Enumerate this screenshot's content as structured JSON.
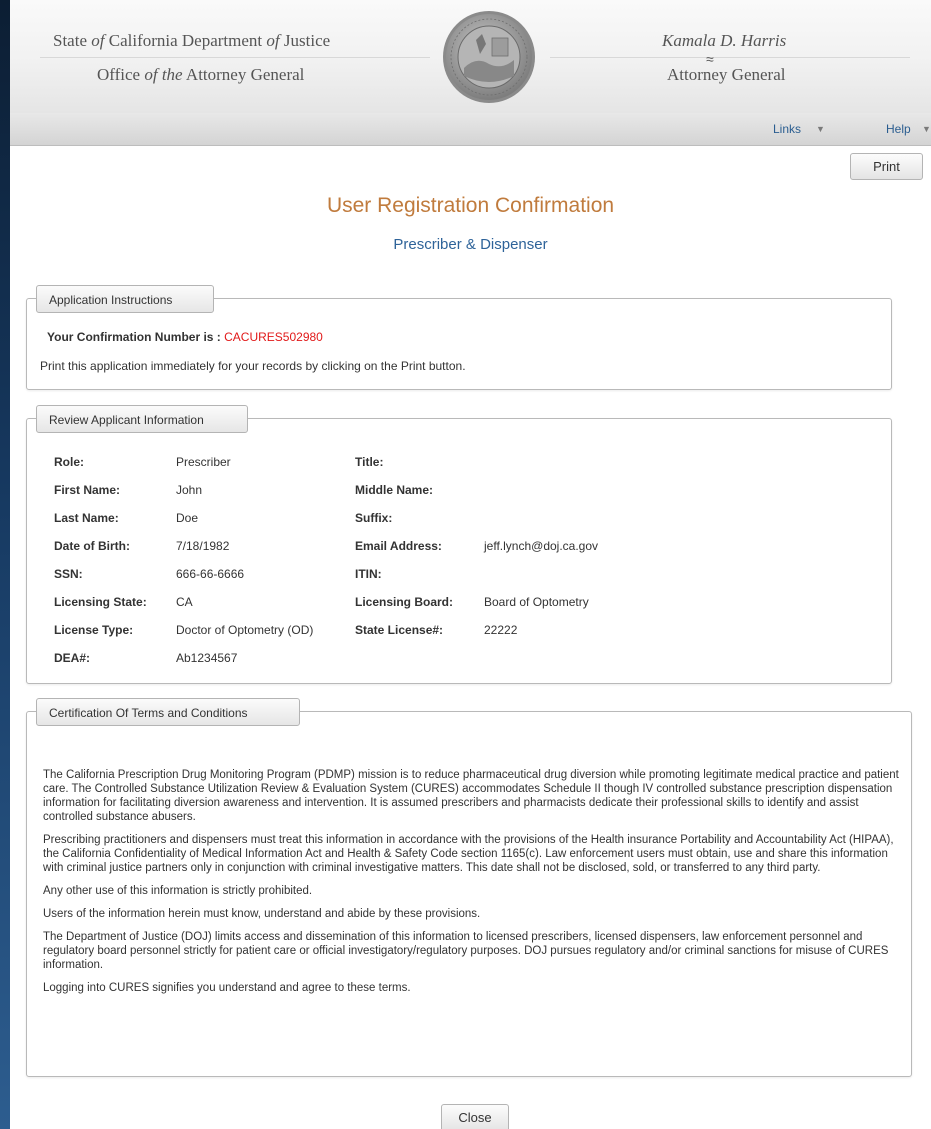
{
  "header": {
    "dept_line1_a": "State ",
    "dept_line1_b": "of",
    "dept_line1_c": " California Department ",
    "dept_line1_d": "of",
    "dept_line1_e": " Justice",
    "dept_line2_a": "Office ",
    "dept_line2_b": "of the",
    "dept_line2_c": " Attorney General",
    "ag_name": "Kamala D. Harris",
    "ag_title": "Attorney General"
  },
  "nav": {
    "links": "Links",
    "help": "Help"
  },
  "print_label": "Print",
  "page_title": "User Registration Confirmation",
  "page_subtitle": "Prescriber & Dispenser",
  "instructions": {
    "legend": "Application Instructions",
    "confirm_label": "Your Confirmation Number is : ",
    "confirm_number": "CACURES502980",
    "note": "Print this application immediately for your records by clicking on the Print button."
  },
  "review": {
    "legend": "Review Applicant Information",
    "left": [
      {
        "label": "Role:",
        "value": "Prescriber"
      },
      {
        "label": "First Name:",
        "value": "John"
      },
      {
        "label": "Last Name:",
        "value": "Doe"
      },
      {
        "label": "Date of Birth:",
        "value": "7/18/1982"
      },
      {
        "label": "SSN:",
        "value": "666-66-6666"
      },
      {
        "label": "Licensing State:",
        "value": "CA"
      },
      {
        "label": "License Type:",
        "value": "Doctor of Optometry (OD)"
      },
      {
        "label": "DEA#:",
        "value": "Ab1234567"
      }
    ],
    "right": [
      {
        "label": "Title:",
        "value": ""
      },
      {
        "label": "Middle Name:",
        "value": ""
      },
      {
        "label": "Suffix:",
        "value": ""
      },
      {
        "label": "Email Address:",
        "value": "jeff.lynch@doj.ca.gov"
      },
      {
        "label": "ITIN:",
        "value": ""
      },
      {
        "label": "Licensing Board:",
        "value": "Board of Optometry"
      },
      {
        "label": "State License#:",
        "value": "22222"
      }
    ]
  },
  "terms": {
    "legend": "Certification Of Terms and Conditions",
    "paragraphs": [
      "The California Prescription Drug Monitoring Program (PDMP) mission is to reduce pharmaceutical drug diversion while promoting legitimate medical practice and patient care. The Controlled Substance Utilization Review & Evaluation System (CURES) accommodates Schedule II though IV controlled substance prescription dispensation information for facilitating diversion awareness and intervention. It is assumed prescribers and pharmacists dedicate their professional skills to identify and assist controlled substance abusers.",
      "Prescribing practitioners and dispensers must treat this information in accordance with the provisions of the Health insurance Portability and Accountability Act (HIPAA), the California Confidentiality of Medical Information Act and Health & Safety Code section 1165(c). Law enforcement users must obtain, use and share this information with criminal justice partners only in conjunction with criminal investigative matters. This date shall not be disclosed, sold, or transferred to any third party.",
      "Any other use of this information is strictly prohibited.",
      "Users of the information herein must know, understand and abide by these provisions.",
      "The Department of Justice (DOJ) limits access and dissemination of this information to licensed prescribers, licensed dispensers, law enforcement personnel and regulatory board personnel strictly for patient care or official investigatory/regulatory purposes. DOJ pursues regulatory and/or criminal sanctions for misuse of CURES information.",
      "Logging into CURES signifies you understand and agree to these terms."
    ]
  },
  "close_label": "Close"
}
